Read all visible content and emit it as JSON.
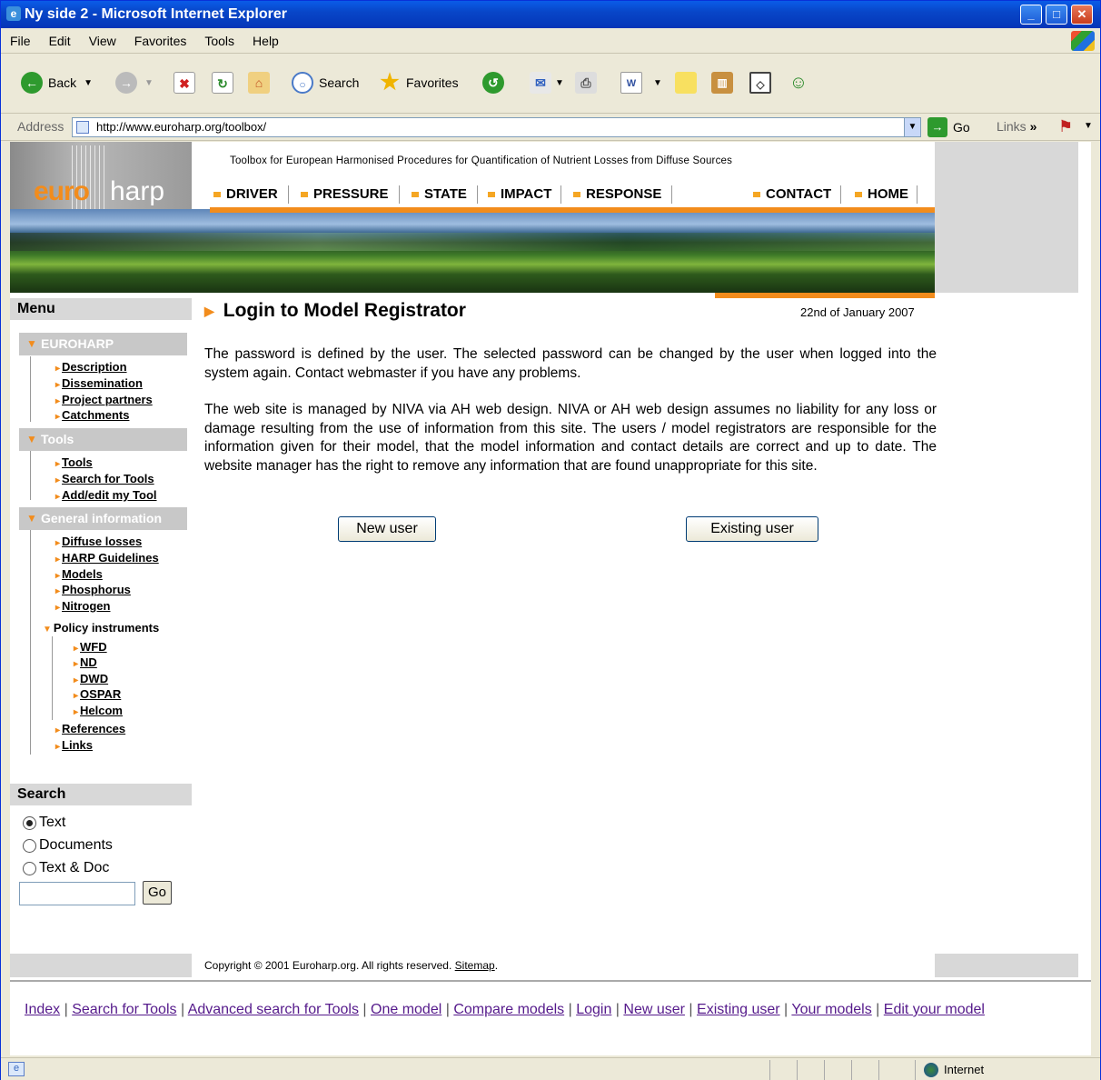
{
  "window": {
    "title": "Ny side 2 - Microsoft Internet Explorer"
  },
  "menubar": {
    "items": [
      "File",
      "Edit",
      "View",
      "Favorites",
      "Tools",
      "Help"
    ]
  },
  "toolbar": {
    "back": "Back",
    "search": "Search",
    "favorites": "Favorites"
  },
  "address": {
    "label": "Address",
    "url": "http://www.euroharp.org/toolbox/",
    "go": "Go",
    "links": "Links"
  },
  "header": {
    "logo_euro": "euro",
    "logo_harp": "harp",
    "tagline": "Toolbox for European Harmonised Procedures for Quantification of Nutrient Losses from Diffuse Sources",
    "nav": [
      "DRIVER",
      "PRESSURE",
      "STATE",
      "IMPACT",
      "RESPONSE",
      "CONTACT",
      "HOME"
    ]
  },
  "sidebar": {
    "menu_title": "Menu",
    "sections": [
      {
        "title": "EUROHARP",
        "items": [
          "Description",
          "Dissemination",
          "Project partners",
          "Catchments"
        ]
      },
      {
        "title": "Tools",
        "items": [
          "Tools",
          "Search for Tools",
          "Add/edit my Tool"
        ]
      },
      {
        "title": "General information",
        "items": [
          "Diffuse losses",
          "HARP Guidelines",
          "Models",
          "Phosphorus",
          "Nitrogen"
        ]
      }
    ],
    "policy": {
      "title": "Policy instruments",
      "items": [
        "WFD",
        "ND",
        "DWD",
        "OSPAR",
        "Helcom"
      ]
    },
    "extra": [
      "References",
      "Links"
    ]
  },
  "search": {
    "title": "Search",
    "options": [
      "Text",
      "Documents",
      "Text & Doc"
    ],
    "selected": "Text",
    "go": "Go"
  },
  "main": {
    "title": "Login to Model Registrator",
    "date": "22nd of January 2007",
    "para1": "The password is defined by the user. The selected password can be changed by the user when logged into the system again. Contact webmaster if you have any problems.",
    "para2": "The web site is managed by NIVA via AH web design. NIVA or AH web design assumes no liability for any loss or damage resulting from the use of information from this site. The users / model registrators are responsible for the information given for their model, that the model information and contact details are correct and up to date. The website manager has the right to remove any information that are found unappropriate for this site.",
    "new_user": "New user",
    "existing_user": "Existing user"
  },
  "footer": {
    "copyright": "Copyright © 2001 Euroharp.org. All rights reserved.",
    "sitemap": "Sitemap",
    "period": "."
  },
  "bottom_links": [
    "Index",
    "Search for Tools",
    "Advanced search for Tools",
    "One model",
    "Compare models",
    "Login",
    "New user",
    "Existing user",
    "Your models",
    "Edit your model"
  ],
  "status": {
    "zone": "Internet"
  }
}
